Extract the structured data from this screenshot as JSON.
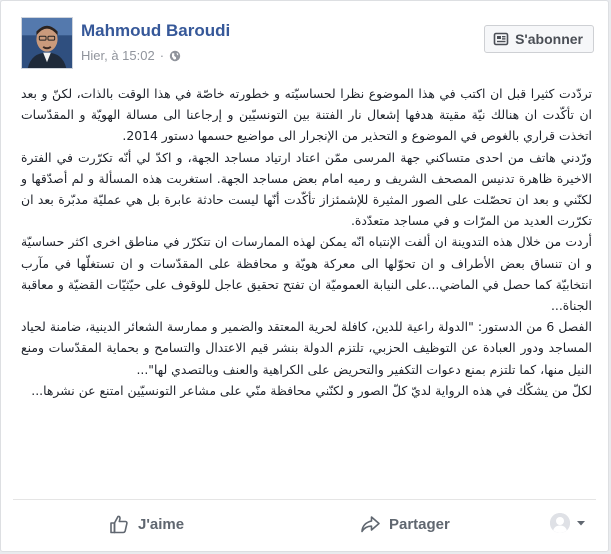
{
  "post": {
    "author": "Mahmoud Baroudi",
    "timestamp": "Hier, à 15:02",
    "timestamp_separator": "·",
    "privacy_icon": "globe-icon",
    "subscribe_label": "S'abonner",
    "subscribe_icon": "subscribe-icon",
    "paragraphs": [
      "تردّدت كثيرا قبل ان اكتب في هذا الموضوع نظرا لحساسيّته و خطورته خاصّة في هذا الوقت بالذات، لكنّ و بعد ان تأكّدت ان هنالك نيّة مقيتة هدفها إشعال نار الفتنة بين التونسيّين و إرجاعنا الى مسالة الهويّة و المقدّسات اتخذت قراري بالغوص في الموضوع و التحذير من الإنجرار الى مواضيع حسمها دستور 2014.",
      "ورّدني هاتف من احدى متساكني جهة المرسى ممّن اعتاد ارتياد مساجد الجهة، و اكدّ لي أنّه تكرّرت في الفترة الاخيرة ظاهرة تدنيس المصحف الشريف و رميه امام بعض مساجد الجهة. استغربت هذه المسألة و لم أصدّقها و لكنّني و بعد ان تحصّلت على الصور المثيرة للإشمئزاز تأكّدت أنّها ليست حادثة عابرة بل هي عمليّة مدبّرة بعد ان تكرّرت العديد من المرّات و في مساجد متعدّدة.",
      "أردت من خلال هذه التدوينة ان ألفت الإنتباه انّه يمكن لهذه الممارسات ان تتكرّر في مناطق اخرى اكثر حساسيّة و ان تنساق بعض الأطراف و ان تحوّلها الى معركة هويّة و محافظة على المقدّسات و ان تستغلّها في مآرب انتخابيّة كما حصل في الماضي...على النيابة العموميّة ان تفتح تحقيق عاجل للوقوف على حيّثيّات القضيّة و معاقبة الجناة...",
      "الفصل 6 من الدستور: \"الدولة راعية للدين، كافلة لحرية المعتقد والضمير و ممارسة الشعائر الدينية، ضامنة لحياد المساجد ودور العبادة عن التوظيف الحزبي، تلتزم الدولة بنشر قيم الاعتدال والتسامح و بحماية المقدّسات ومنع النيل منها، كما تلتزم بمنع دعوات التكفير والتحريض على الكراهية والعنف وبالتصدي لها\"...",
      "لكلّ من يشكّك في هذه الرواية لديّ كلّ الصور و لكنّني محافظة منّي على مشاعر التونسيّين امتنع عن نشرها..."
    ]
  },
  "actions": {
    "like_label": "J'aime",
    "like_icon": "thumbs-up-icon",
    "share_label": "Partager",
    "share_icon": "share-arrow-icon",
    "viewer_icon": "user-avatar-icon",
    "viewer_dropdown_icon": "caret-down-icon"
  },
  "colors": {
    "author_link": "#365899",
    "meta_text": "#90949c",
    "action_text": "#606770",
    "card_background": "#ffffff",
    "page_background": "#e9ebee"
  }
}
